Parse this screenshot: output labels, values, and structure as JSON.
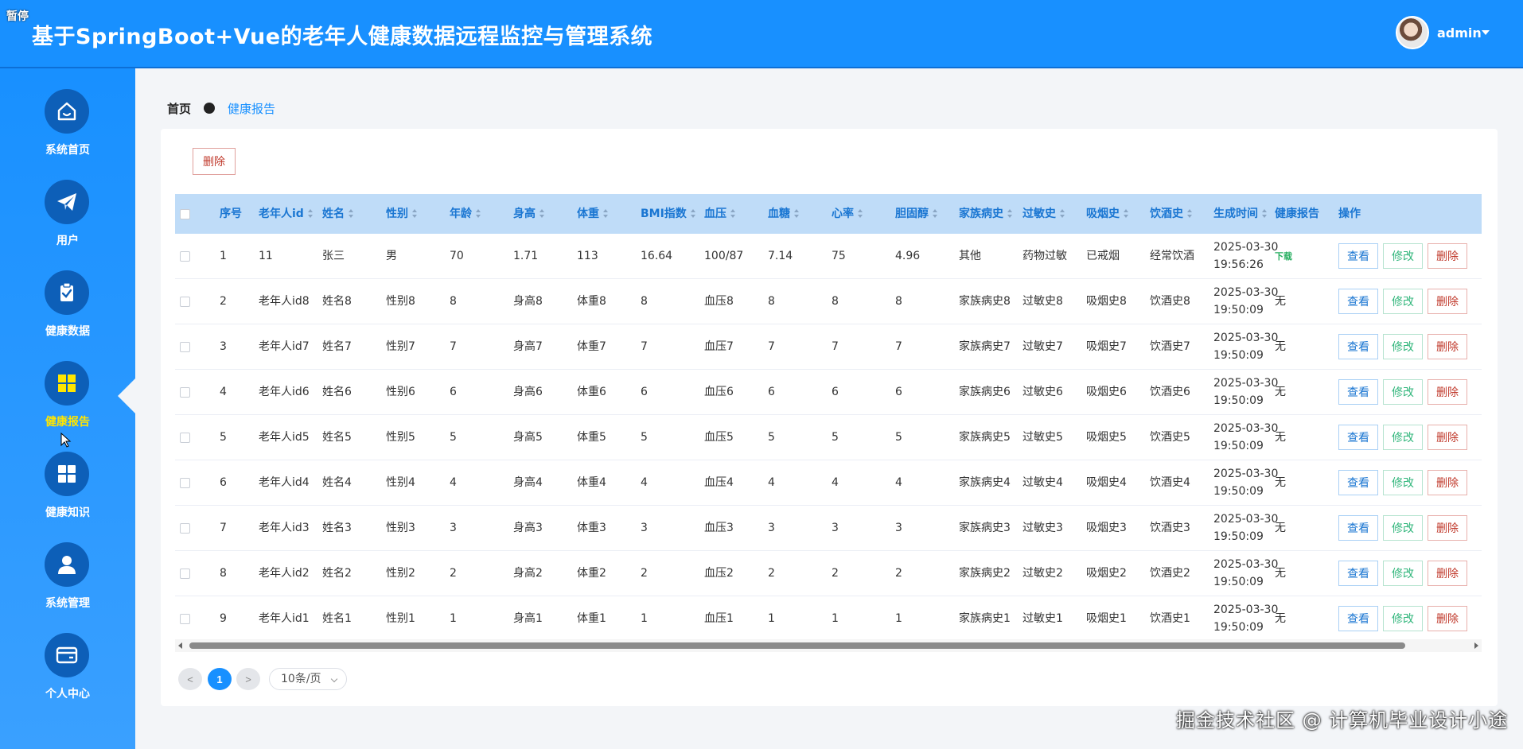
{
  "header": {
    "pause_tag": "暂停",
    "title": "基于SpringBoot+Vue的老年人健康数据远程监控与管理系统",
    "user": "admin"
  },
  "sidebar": {
    "items": [
      {
        "label": "系统首页",
        "icon": "home-icon"
      },
      {
        "label": "用户",
        "icon": "paper-plane-icon"
      },
      {
        "label": "健康数据",
        "icon": "clipboard-check-icon"
      },
      {
        "label": "健康报告",
        "icon": "grid-icon",
        "active": true
      },
      {
        "label": "健康知识",
        "icon": "grid-icon"
      },
      {
        "label": "系统管理",
        "icon": "user-icon"
      },
      {
        "label": "个人中心",
        "icon": "wallet-icon"
      }
    ]
  },
  "breadcrumb": {
    "home": "首页",
    "current": "健康报告"
  },
  "toolbar": {
    "delete_label": "删除"
  },
  "table": {
    "columns": [
      "序号",
      "老年人id",
      "姓名",
      "性别",
      "年龄",
      "身高",
      "体重",
      "BMI指数",
      "血压",
      "血糖",
      "心率",
      "胆固醇",
      "家族病史",
      "过敏史",
      "吸烟史",
      "饮酒史",
      "生成时间",
      "健康报告",
      "操作"
    ],
    "rows": [
      [
        "1",
        "11",
        "张三",
        "男",
        "70",
        "1.71",
        "113",
        "16.64",
        "100/87",
        "7.14",
        "75",
        "4.96",
        "其他",
        "药物过敏",
        "已戒烟",
        "经常饮酒",
        "2025-03-30",
        "19:56:26",
        "下载"
      ],
      [
        "2",
        "老年人id8",
        "姓名8",
        "性别8",
        "8",
        "身高8",
        "体重8",
        "8",
        "血压8",
        "8",
        "8",
        "8",
        "家族病史8",
        "过敏史8",
        "吸烟史8",
        "饮酒史8",
        "2025-03-30",
        "19:50:09",
        "无"
      ],
      [
        "3",
        "老年人id7",
        "姓名7",
        "性别7",
        "7",
        "身高7",
        "体重7",
        "7",
        "血压7",
        "7",
        "7",
        "7",
        "家族病史7",
        "过敏史7",
        "吸烟史7",
        "饮酒史7",
        "2025-03-30",
        "19:50:09",
        "无"
      ],
      [
        "4",
        "老年人id6",
        "姓名6",
        "性别6",
        "6",
        "身高6",
        "体重6",
        "6",
        "血压6",
        "6",
        "6",
        "6",
        "家族病史6",
        "过敏史6",
        "吸烟史6",
        "饮酒史6",
        "2025-03-30",
        "19:50:09",
        "无"
      ],
      [
        "5",
        "老年人id5",
        "姓名5",
        "性别5",
        "5",
        "身高5",
        "体重5",
        "5",
        "血压5",
        "5",
        "5",
        "5",
        "家族病史5",
        "过敏史5",
        "吸烟史5",
        "饮酒史5",
        "2025-03-30",
        "19:50:09",
        "无"
      ],
      [
        "6",
        "老年人id4",
        "姓名4",
        "性别4",
        "4",
        "身高4",
        "体重4",
        "4",
        "血压4",
        "4",
        "4",
        "4",
        "家族病史4",
        "过敏史4",
        "吸烟史4",
        "饮酒史4",
        "2025-03-30",
        "19:50:09",
        "无"
      ],
      [
        "7",
        "老年人id3",
        "姓名3",
        "性别3",
        "3",
        "身高3",
        "体重3",
        "3",
        "血压3",
        "3",
        "3",
        "3",
        "家族病史3",
        "过敏史3",
        "吸烟史3",
        "饮酒史3",
        "2025-03-30",
        "19:50:09",
        "无"
      ],
      [
        "8",
        "老年人id2",
        "姓名2",
        "性别2",
        "2",
        "身高2",
        "体重2",
        "2",
        "血压2",
        "2",
        "2",
        "2",
        "家族病史2",
        "过敏史2",
        "吸烟史2",
        "饮酒史2",
        "2025-03-30",
        "19:50:09",
        "无"
      ],
      [
        "9",
        "老年人id1",
        "姓名1",
        "性别1",
        "1",
        "身高1",
        "体重1",
        "1",
        "血压1",
        "1",
        "1",
        "1",
        "家族病史1",
        "过敏史1",
        "吸烟史1",
        "饮酒史1",
        "2025-03-30",
        "19:50:09",
        "无"
      ]
    ],
    "actions": {
      "view": "查看",
      "edit": "修改",
      "delete": "删除"
    }
  },
  "pagination": {
    "prev": "<",
    "current": "1",
    "next": ">",
    "page_size": "10条/页"
  },
  "watermark": "掘金技术社区 @ 计算机毕业设计小途",
  "colors": {
    "primary": "#1890ff",
    "active_nav": "#ffe600",
    "danger": "#c0392b",
    "success": "#2fb57a"
  }
}
